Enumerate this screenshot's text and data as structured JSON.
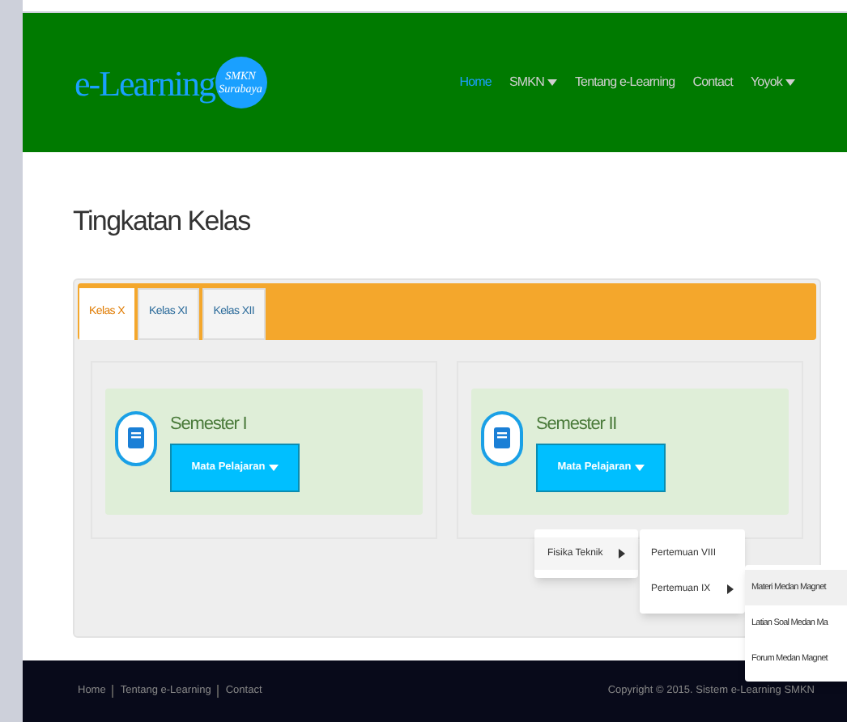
{
  "header": {
    "logo_text": "e-Learning",
    "badge_lines": [
      "SMKN",
      "Surabaya"
    ],
    "nav": [
      {
        "label": "Home",
        "selected": true,
        "dropdown": false
      },
      {
        "label": "SMKN",
        "selected": false,
        "dropdown": true
      },
      {
        "label": "Tentang e-Learning",
        "selected": false,
        "dropdown": false
      },
      {
        "label": "Contact",
        "selected": false,
        "dropdown": false
      },
      {
        "label": "Yoyok",
        "selected": false,
        "dropdown": true
      }
    ]
  },
  "page_title": "Tingkatan Kelas",
  "tabs": [
    {
      "label": "Kelas X",
      "selected": true
    },
    {
      "label": "Kelas XI",
      "selected": false
    },
    {
      "label": "Kelas XII",
      "selected": false
    }
  ],
  "semesters": [
    {
      "title": "Semester I",
      "button": "Mata Pelajaran"
    },
    {
      "title": "Semester II",
      "button": "Mata Pelajaran"
    }
  ],
  "menu": [
    {
      "label": "Fisika Teknik",
      "submenu": true
    }
  ],
  "submenu": [
    {
      "label": "Pertemuan VIII",
      "submenu": false
    },
    {
      "label": "Pertemuan IX",
      "submenu": true
    }
  ],
  "submenu2": [
    {
      "label": "Materi Medan Magnet",
      "selected": true
    },
    {
      "label": "Latian Soal Medan Ma",
      "selected": false
    },
    {
      "label": "Forum Medan Magnet",
      "selected": false
    }
  ],
  "footer": {
    "links": [
      "Home",
      "Tentang e-Learning",
      "Contact"
    ],
    "copyright": "Copyright © 2015.  Sistem e-Learning SMKN"
  }
}
